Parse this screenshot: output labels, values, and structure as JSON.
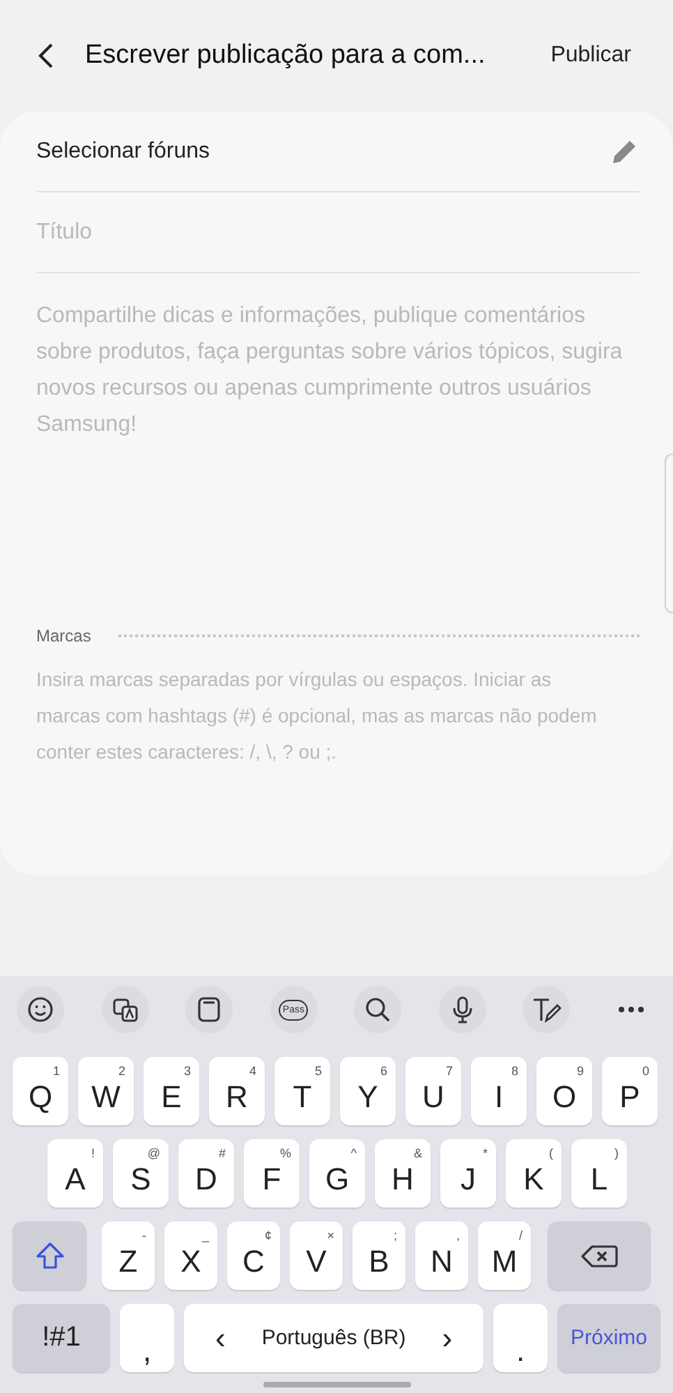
{
  "header": {
    "title": "Escrever publicação para a com...",
    "action": "Publicar"
  },
  "form": {
    "forum_selector": "Selecionar fóruns",
    "title_placeholder": "Título",
    "body_placeholder": "Compartilhe dicas e informações, publique comentários sobre produtos, faça perguntas sobre vários tópicos, sugira novos recursos ou apenas cumprimente outros usuários Samsung!",
    "tags_label": "Marcas",
    "tags_placeholder": "Insira marcas separadas por vírgulas ou espaços. Iniciar as marcas com hashtags (#) é opcional, mas as marcas não podem conter estes caracteres: /, \\, ? ou ;."
  },
  "keyboard": {
    "toolbar": [
      {
        "kind": "emoji"
      },
      {
        "kind": "translate"
      },
      {
        "kind": "clipboard"
      },
      {
        "kind": "pass",
        "label": "Pass"
      },
      {
        "kind": "search"
      },
      {
        "kind": "mic"
      },
      {
        "kind": "handwriting"
      },
      {
        "kind": "more"
      }
    ],
    "rows": [
      {
        "keys": [
          {
            "kind": "char",
            "label": "Q",
            "hint": "1"
          },
          {
            "kind": "char",
            "label": "W",
            "hint": "2"
          },
          {
            "kind": "char",
            "label": "E",
            "hint": "3"
          },
          {
            "kind": "char",
            "label": "R",
            "hint": "4"
          },
          {
            "kind": "char",
            "label": "T",
            "hint": "5"
          },
          {
            "kind": "char",
            "label": "Y",
            "hint": "6"
          },
          {
            "kind": "char",
            "label": "U",
            "hint": "7"
          },
          {
            "kind": "char",
            "label": "I",
            "hint": "8"
          },
          {
            "kind": "char",
            "label": "O",
            "hint": "9"
          },
          {
            "kind": "char",
            "label": "P",
            "hint": "0"
          }
        ]
      },
      {
        "keys": [
          {
            "kind": "char",
            "label": "A",
            "hint": "!"
          },
          {
            "kind": "char",
            "label": "S",
            "hint": "@"
          },
          {
            "kind": "char",
            "label": "D",
            "hint": "#"
          },
          {
            "kind": "char",
            "label": "F",
            "hint": "%"
          },
          {
            "kind": "char",
            "label": "G",
            "hint": "^"
          },
          {
            "kind": "char",
            "label": "H",
            "hint": "&"
          },
          {
            "kind": "char",
            "label": "J",
            "hint": "*"
          },
          {
            "kind": "char",
            "label": "K",
            "hint": "("
          },
          {
            "kind": "char",
            "label": "L",
            "hint": ")"
          }
        ]
      },
      {
        "keys": [
          {
            "kind": "shift"
          },
          {
            "kind": "char",
            "label": "Z",
            "hint": "-"
          },
          {
            "kind": "char",
            "label": "X",
            "hint": "_"
          },
          {
            "kind": "char",
            "label": "C",
            "hint": "¢"
          },
          {
            "kind": "char",
            "label": "V",
            "hint": "×"
          },
          {
            "kind": "char",
            "label": "B",
            "hint": ";"
          },
          {
            "kind": "char",
            "label": "N",
            "hint": ","
          },
          {
            "kind": "char",
            "label": "M",
            "hint": "/"
          },
          {
            "kind": "backspace"
          }
        ]
      },
      {
        "keys": [
          {
            "kind": "symbols",
            "label": "!#1"
          },
          {
            "kind": "char",
            "label": ","
          },
          {
            "kind": "space",
            "label": "Português (BR)",
            "prev": "‹",
            "next": "›"
          },
          {
            "kind": "char",
            "label": "."
          },
          {
            "kind": "action",
            "label": "Próximo"
          }
        ]
      }
    ]
  }
}
